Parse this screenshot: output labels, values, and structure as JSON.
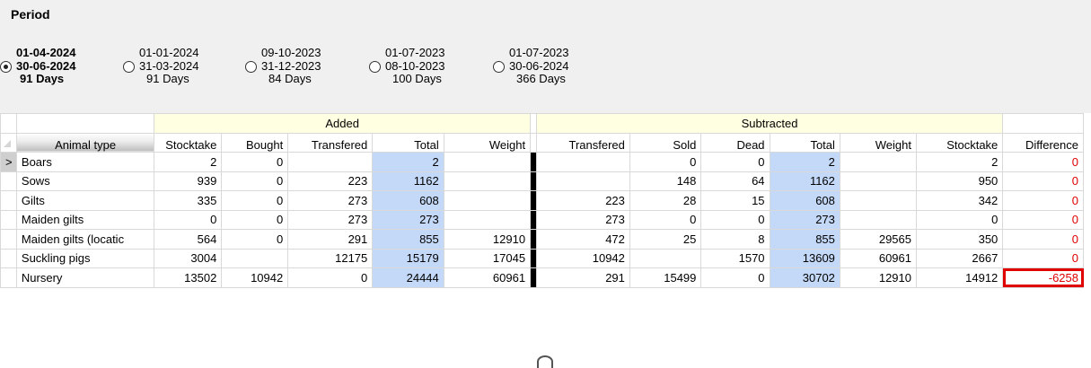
{
  "period": {
    "title": "Period",
    "options": [
      {
        "start": "01-04-2024",
        "end": "30-06-2024",
        "days": "91 Days",
        "selected": true
      },
      {
        "start": "01-01-2024",
        "end": "31-03-2024",
        "days": "91 Days",
        "selected": false
      },
      {
        "start": "09-10-2023",
        "end": "31-12-2023",
        "days": "84 Days",
        "selected": false
      },
      {
        "start": "01-07-2023",
        "end": "08-10-2023",
        "days": "100 Days",
        "selected": false
      },
      {
        "start": "01-07-2023",
        "end": "30-06-2024",
        "days": "366 Days",
        "selected": false
      }
    ]
  },
  "grid": {
    "groups": {
      "added": "Added",
      "subtracted": "Subtracted"
    },
    "columns": {
      "animal_type": "Animal type",
      "added": [
        "Stocktake",
        "Bought",
        "Transfered",
        "Total",
        "Weight"
      ],
      "subtracted": [
        "Transfered",
        "Sold",
        "Dead",
        "Total",
        "Weight",
        "Stocktake"
      ],
      "difference": "Difference"
    },
    "current_row_marker": ">",
    "rows": [
      {
        "name": "Boars",
        "added": [
          "2",
          "0",
          "",
          "2",
          ""
        ],
        "subtracted": [
          "",
          "0",
          "0",
          "2",
          "",
          "2"
        ],
        "difference": "0"
      },
      {
        "name": "Sows",
        "added": [
          "939",
          "0",
          "223",
          "1162",
          ""
        ],
        "subtracted": [
          "",
          "148",
          "64",
          "1162",
          "",
          "950"
        ],
        "difference": "0"
      },
      {
        "name": "Gilts",
        "added": [
          "335",
          "0",
          "273",
          "608",
          ""
        ],
        "subtracted": [
          "223",
          "28",
          "15",
          "608",
          "",
          "342"
        ],
        "difference": "0"
      },
      {
        "name": "Maiden gilts",
        "added": [
          "0",
          "0",
          "273",
          "273",
          ""
        ],
        "subtracted": [
          "273",
          "0",
          "0",
          "273",
          "",
          "0"
        ],
        "difference": "0"
      },
      {
        "name": "Maiden gilts (locatic",
        "added": [
          "564",
          "0",
          "291",
          "855",
          "12910"
        ],
        "subtracted": [
          "472",
          "25",
          "8",
          "855",
          "29565",
          "350"
        ],
        "difference": "0"
      },
      {
        "name": "Suckling pigs",
        "added": [
          "3004",
          "",
          "12175",
          "15179",
          "17045"
        ],
        "subtracted": [
          "10942",
          "",
          "1570",
          "13609",
          "60961",
          "2667"
        ],
        "difference": "0"
      },
      {
        "name": "Nursery",
        "added": [
          "13502",
          "10942",
          "0",
          "24444",
          "60961"
        ],
        "subtracted": [
          "291",
          "15499",
          "0",
          "30702",
          "12910",
          "14912"
        ],
        "difference": "-6258"
      }
    ]
  },
  "colors": {
    "total_bg": "#c4d9f8",
    "group_bg": "#ffffe1",
    "difference_text": "#e00000",
    "highlight_box": "#e00000"
  }
}
